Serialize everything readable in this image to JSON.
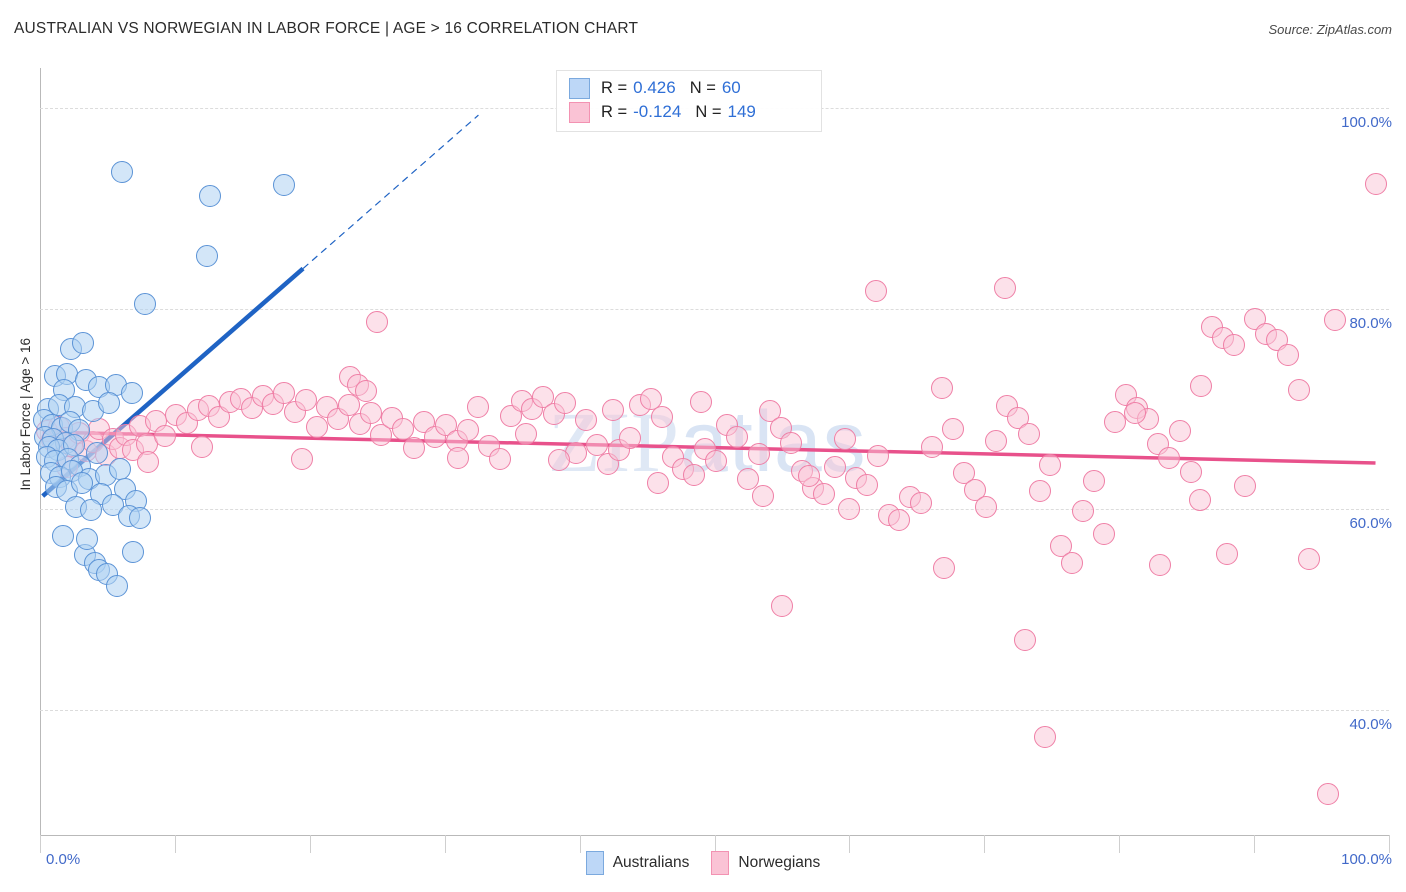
{
  "header": {
    "title": "AUSTRALIAN VS NORWEGIAN IN LABOR FORCE | AGE > 16 CORRELATION CHART",
    "source": "Source: ZipAtlas.com"
  },
  "watermark": {
    "zip": "ZIP",
    "atlas": "atlas"
  },
  "stats": {
    "rows": [
      {
        "series": "Australians",
        "r_label": "R =",
        "r_value": "0.426",
        "n_label": "N =",
        "n_value": "60",
        "color": "#bdd7f7"
      },
      {
        "series": "Norwegians",
        "r_label": "R =",
        "r_value": "-0.124",
        "n_label": "N =",
        "n_value": "149",
        "color": "#fac3d5"
      }
    ]
  },
  "legend": {
    "items": [
      {
        "label": "Australians",
        "color": "#bdd7f7",
        "border": "#7ba9de"
      },
      {
        "label": "Norwegians",
        "color": "#fac3d5",
        "border": "#f392b2"
      }
    ]
  },
  "axes": {
    "y_title": "In Labor Force | Age > 16",
    "y_ticks": [
      "100.0%",
      "80.0%",
      "60.0%",
      "40.0%"
    ],
    "x_ticks": [
      "0.0%",
      "100.0%"
    ],
    "x_min": 0,
    "x_max": 100,
    "y_min": 27.5,
    "y_max": 104.0
  },
  "colors": {
    "blue_fill": "#bdd7f7",
    "blue_stroke": "#5b93d6",
    "blue_line": "#1f63c4",
    "pink_fill": "#fac3d5",
    "pink_stroke": "#ef7fa6",
    "pink_line": "#e8518b",
    "tick_text": "#4169c9",
    "title_text": "#2b2b2b",
    "grid": "#dcdcdc"
  },
  "chart_data": {
    "type": "scatter",
    "title": "AUSTRALIAN VS NORWEGIAN IN LABOR FORCE | AGE > 16 CORRELATION CHART",
    "xlabel": "",
    "ylabel": "In Labor Force | Age > 16",
    "xlim": [
      0,
      100
    ],
    "ylim": [
      27.5,
      104.0
    ],
    "grid": true,
    "x_tick_labels": [
      "0.0%",
      "100.0%"
    ],
    "y_tick_labels": [
      "100.0%",
      "80.0%",
      "60.0%",
      "40.0%"
    ],
    "y_tick_values": [
      100.0,
      80.0,
      60.0,
      40.0
    ],
    "legend_position": "bottom-center",
    "series": [
      {
        "name": "Australians",
        "color": "#bdd7f7",
        "stroke": "#5b93d6",
        "R": 0.426,
        "N": 60,
        "trend": {
          "x0": 0.2,
          "y0": 61.3,
          "x1": 19.5,
          "y1": 84.0,
          "dashed_to_x": 32.5,
          "dashed_to_y": 99.3
        },
        "points": [
          [
            6.1,
            93.6
          ],
          [
            12.6,
            91.2
          ],
          [
            18.1,
            92.3
          ],
          [
            12.4,
            85.2
          ],
          [
            7.8,
            80.5
          ],
          [
            2.3,
            76.0
          ],
          [
            3.2,
            76.6
          ],
          [
            1.1,
            73.3
          ],
          [
            2.0,
            73.5
          ],
          [
            3.4,
            72.9
          ],
          [
            1.8,
            71.9
          ],
          [
            4.4,
            72.2
          ],
          [
            5.6,
            72.4
          ],
          [
            6.8,
            71.6
          ],
          [
            0.6,
            70.0
          ],
          [
            1.4,
            70.4
          ],
          [
            2.6,
            70.2
          ],
          [
            3.9,
            69.8
          ],
          [
            5.1,
            70.6
          ],
          [
            0.3,
            68.9
          ],
          [
            0.9,
            68.4
          ],
          [
            1.6,
            68.1
          ],
          [
            2.2,
            68.7
          ],
          [
            2.9,
            67.9
          ],
          [
            0.4,
            67.2
          ],
          [
            1.0,
            67.0
          ],
          [
            1.9,
            66.6
          ],
          [
            0.7,
            66.2
          ],
          [
            1.3,
            65.9
          ],
          [
            2.5,
            66.4
          ],
          [
            0.5,
            65.2
          ],
          [
            1.1,
            64.8
          ],
          [
            2.1,
            65.0
          ],
          [
            3.0,
            64.3
          ],
          [
            4.2,
            65.6
          ],
          [
            0.8,
            63.6
          ],
          [
            1.5,
            63.2
          ],
          [
            2.4,
            63.8
          ],
          [
            3.6,
            63.0
          ],
          [
            4.9,
            63.4
          ],
          [
            5.9,
            64.0
          ],
          [
            1.2,
            62.2
          ],
          [
            2.0,
            61.8
          ],
          [
            3.1,
            62.6
          ],
          [
            4.5,
            61.5
          ],
          [
            6.3,
            62.0
          ],
          [
            7.1,
            60.8
          ],
          [
            2.7,
            60.2
          ],
          [
            3.8,
            59.9
          ],
          [
            5.4,
            60.4
          ],
          [
            6.6,
            59.3
          ],
          [
            7.4,
            59.1
          ],
          [
            1.7,
            57.3
          ],
          [
            3.3,
            55.4
          ],
          [
            4.1,
            54.6
          ],
          [
            6.9,
            55.7
          ],
          [
            4.4,
            53.9
          ],
          [
            5.0,
            53.5
          ],
          [
            5.7,
            52.3
          ],
          [
            3.5,
            57.0
          ]
        ]
      },
      {
        "name": "Norwegians",
        "color": "#fac3d5",
        "stroke": "#ef7fa6",
        "R": -0.124,
        "N": 149,
        "trend": {
          "x0": 0.2,
          "y0": 67.7,
          "x1": 99.0,
          "y1": 64.6
        },
        "points": [
          [
            0.5,
            67.8
          ],
          [
            0.9,
            66.9
          ],
          [
            1.4,
            68.2
          ],
          [
            1.9,
            67.1
          ],
          [
            2.4,
            66.3
          ],
          [
            2.9,
            67.6
          ],
          [
            3.4,
            65.8
          ],
          [
            3.9,
            66.7
          ],
          [
            4.4,
            68.0
          ],
          [
            4.9,
            65.4
          ],
          [
            5.4,
            67.0
          ],
          [
            5.9,
            66.1
          ],
          [
            6.4,
            67.4
          ],
          [
            6.9,
            65.9
          ],
          [
            7.4,
            68.3
          ],
          [
            7.9,
            66.5
          ],
          [
            8.6,
            68.8
          ],
          [
            9.3,
            67.3
          ],
          [
            10.1,
            69.4
          ],
          [
            10.9,
            68.6
          ],
          [
            11.7,
            69.9
          ],
          [
            12.5,
            70.3
          ],
          [
            13.3,
            69.2
          ],
          [
            14.1,
            70.7
          ],
          [
            14.9,
            71.0
          ],
          [
            15.7,
            70.1
          ],
          [
            16.5,
            71.3
          ],
          [
            17.3,
            70.5
          ],
          [
            18.1,
            71.6
          ],
          [
            18.9,
            69.7
          ],
          [
            19.7,
            70.9
          ],
          [
            20.5,
            68.2
          ],
          [
            21.3,
            70.2
          ],
          [
            22.1,
            69.0
          ],
          [
            22.9,
            70.4
          ],
          [
            23.7,
            68.5
          ],
          [
            24.5,
            69.6
          ],
          [
            25.3,
            67.4
          ],
          [
            26.1,
            69.1
          ],
          [
            26.9,
            68.0
          ],
          [
            27.7,
            66.1
          ],
          [
            28.5,
            68.7
          ],
          [
            25.0,
            78.7
          ],
          [
            23.0,
            73.2
          ],
          [
            23.6,
            72.4
          ],
          [
            24.2,
            71.8
          ],
          [
            29.3,
            67.2
          ],
          [
            30.1,
            68.4
          ],
          [
            30.9,
            66.8
          ],
          [
            31.7,
            67.9
          ],
          [
            32.5,
            70.2
          ],
          [
            33.3,
            66.3
          ],
          [
            34.1,
            65.0
          ],
          [
            34.9,
            69.3
          ],
          [
            35.7,
            70.8
          ],
          [
            36.5,
            70.0
          ],
          [
            37.3,
            71.2
          ],
          [
            38.1,
            69.5
          ],
          [
            38.9,
            70.6
          ],
          [
            39.7,
            65.6
          ],
          [
            40.5,
            68.9
          ],
          [
            41.3,
            66.4
          ],
          [
            42.1,
            64.5
          ],
          [
            42.9,
            65.9
          ],
          [
            43.7,
            67.1
          ],
          [
            44.5,
            70.4
          ],
          [
            45.3,
            71.0
          ],
          [
            46.1,
            69.2
          ],
          [
            46.9,
            65.2
          ],
          [
            47.7,
            64.0
          ],
          [
            48.5,
            63.4
          ],
          [
            49.3,
            66.0
          ],
          [
            50.1,
            64.8
          ],
          [
            50.9,
            68.4
          ],
          [
            51.7,
            67.2
          ],
          [
            52.5,
            63.0
          ],
          [
            53.3,
            65.5
          ],
          [
            54.1,
            69.8
          ],
          [
            54.9,
            68.1
          ],
          [
            55.7,
            66.6
          ],
          [
            56.5,
            63.8
          ],
          [
            57.3,
            62.1
          ],
          [
            58.1,
            61.5
          ],
          [
            58.9,
            64.2
          ],
          [
            59.7,
            67.0
          ],
          [
            60.5,
            63.1
          ],
          [
            61.3,
            62.4
          ],
          [
            62.1,
            65.3
          ],
          [
            62.9,
            59.4
          ],
          [
            63.7,
            58.9
          ],
          [
            64.5,
            61.2
          ],
          [
            65.3,
            60.6
          ],
          [
            66.1,
            66.2
          ],
          [
            66.9,
            72.1
          ],
          [
            67.7,
            68.0
          ],
          [
            68.5,
            63.6
          ],
          [
            69.3,
            61.9
          ],
          [
            70.1,
            60.2
          ],
          [
            70.9,
            66.8
          ],
          [
            71.7,
            70.3
          ],
          [
            72.5,
            69.1
          ],
          [
            73.3,
            67.5
          ],
          [
            74.1,
            61.8
          ],
          [
            74.9,
            64.4
          ],
          [
            75.7,
            56.3
          ],
          [
            76.5,
            54.6
          ],
          [
            77.3,
            59.8
          ],
          [
            78.1,
            62.8
          ],
          [
            78.9,
            57.5
          ],
          [
            79.7,
            68.7
          ],
          [
            80.5,
            71.4
          ],
          [
            81.3,
            70.1
          ],
          [
            82.1,
            69.0
          ],
          [
            82.9,
            66.5
          ],
          [
            83.7,
            65.1
          ],
          [
            84.5,
            67.8
          ],
          [
            85.3,
            63.7
          ],
          [
            86.1,
            72.3
          ],
          [
            86.9,
            78.2
          ],
          [
            87.7,
            77.1
          ],
          [
            88.5,
            76.4
          ],
          [
            89.3,
            62.3
          ],
          [
            90.1,
            79.0
          ],
          [
            90.9,
            77.5
          ],
          [
            91.7,
            76.9
          ],
          [
            92.5,
            75.4
          ],
          [
            93.3,
            71.9
          ],
          [
            94.1,
            55.0
          ],
          [
            62.0,
            81.8
          ],
          [
            71.5,
            82.1
          ],
          [
            55.0,
            50.3
          ],
          [
            73.0,
            46.9
          ],
          [
            74.5,
            37.3
          ],
          [
            86.0,
            60.9
          ],
          [
            81.2,
            69.6
          ],
          [
            88.0,
            55.5
          ],
          [
            96.0,
            78.9
          ],
          [
            99.0,
            92.4
          ],
          [
            95.5,
            31.6
          ],
          [
            83.0,
            54.4
          ],
          [
            67.0,
            54.1
          ],
          [
            60.0,
            60.0
          ],
          [
            53.6,
            61.3
          ],
          [
            45.8,
            62.6
          ],
          [
            38.5,
            64.9
          ],
          [
            31.0,
            65.1
          ],
          [
            19.4,
            65.0
          ],
          [
            12.0,
            66.2
          ],
          [
            8.0,
            64.7
          ],
          [
            2.0,
            64.2
          ],
          [
            36.0,
            67.5
          ],
          [
            42.5,
            69.9
          ],
          [
            49.0,
            70.7
          ],
          [
            57.0,
            63.3
          ]
        ]
      }
    ]
  }
}
